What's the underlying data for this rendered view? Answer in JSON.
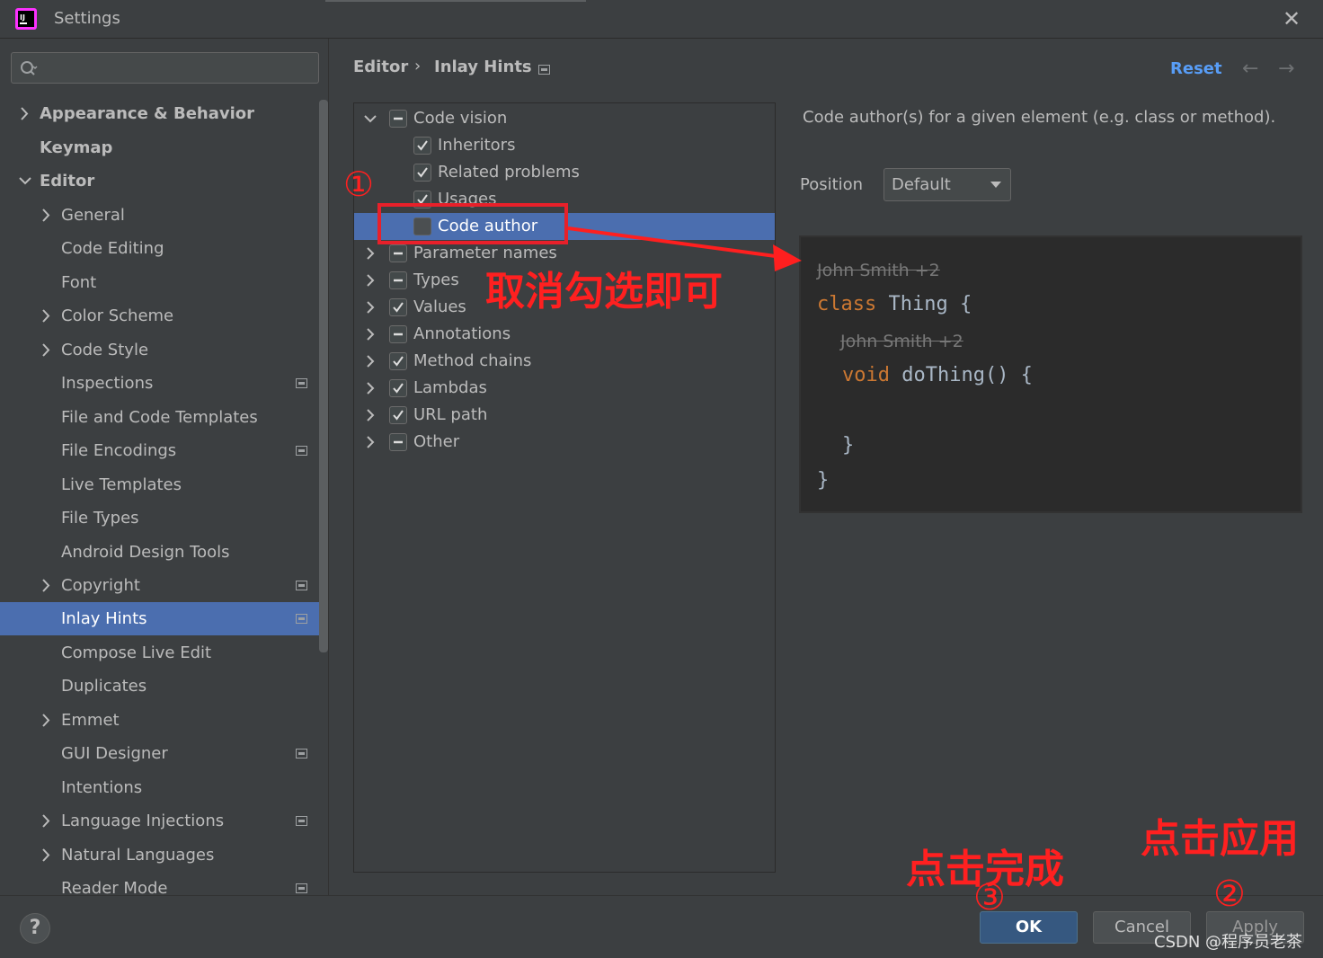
{
  "window": {
    "title": "Settings"
  },
  "search": {
    "placeholder": ""
  },
  "sidebar": {
    "items": [
      {
        "label": "Appearance & Behavior"
      },
      {
        "label": "Keymap"
      },
      {
        "label": "Editor"
      },
      {
        "label": "General"
      },
      {
        "label": "Code Editing"
      },
      {
        "label": "Font"
      },
      {
        "label": "Color Scheme"
      },
      {
        "label": "Code Style"
      },
      {
        "label": "Inspections"
      },
      {
        "label": "File and Code Templates"
      },
      {
        "label": "File Encodings"
      },
      {
        "label": "Live Templates"
      },
      {
        "label": "File Types"
      },
      {
        "label": "Android Design Tools"
      },
      {
        "label": "Copyright"
      },
      {
        "label": "Inlay Hints"
      },
      {
        "label": "Compose Live Edit"
      },
      {
        "label": "Duplicates"
      },
      {
        "label": "Emmet"
      },
      {
        "label": "GUI Designer"
      },
      {
        "label": "Intentions"
      },
      {
        "label": "Language Injections"
      },
      {
        "label": "Natural Languages"
      },
      {
        "label": "Reader Mode"
      }
    ]
  },
  "breadcrumb": {
    "parent": "Editor",
    "separator": "›",
    "current": "Inlay Hints"
  },
  "header": {
    "reset_label": "Reset",
    "back_glyph": "←",
    "forward_glyph": "→"
  },
  "hints": {
    "rows": [
      {
        "label": "Code vision",
        "state": "partial",
        "expanded": true
      },
      {
        "label": "Inheritors",
        "state": "checked"
      },
      {
        "label": "Related problems",
        "state": "checked"
      },
      {
        "label": "Usages",
        "state": "checked"
      },
      {
        "label": "Code author",
        "state": "unchecked",
        "selected": true
      },
      {
        "label": "Parameter names",
        "state": "partial"
      },
      {
        "label": "Types",
        "state": "partial"
      },
      {
        "label": "Values",
        "state": "checked"
      },
      {
        "label": "Annotations",
        "state": "partial"
      },
      {
        "label": "Method chains",
        "state": "checked"
      },
      {
        "label": "Lambdas",
        "state": "checked"
      },
      {
        "label": "URL path",
        "state": "checked"
      },
      {
        "label": "Other",
        "state": "partial"
      }
    ]
  },
  "description": {
    "text": "Code author(s) for a given element (e.g. class or method)."
  },
  "position": {
    "label": "Position",
    "value": "Default"
  },
  "preview": {
    "hint1": "John Smith +2",
    "class_kw": "class",
    "class_name": " Thing {",
    "hint2": "John Smith +2",
    "void_kw": "void",
    "method": " doThing() {",
    "close_inner": "}",
    "close_outer": "}"
  },
  "buttons": {
    "help": "?",
    "ok": "OK",
    "cancel": "Cancel",
    "apply": "Apply"
  },
  "annotations": {
    "step1": "①",
    "uncheck_note": "取消勾选即可",
    "step2": "②",
    "apply_note": "点击应用",
    "step3": "③",
    "done_note": "点击完成",
    "watermark": "CSDN @程序员老茶"
  },
  "colors": {
    "accent": "#4b6eaf",
    "link": "#589df6",
    "annotation": "#ff2020",
    "ok_button": "#365880"
  }
}
